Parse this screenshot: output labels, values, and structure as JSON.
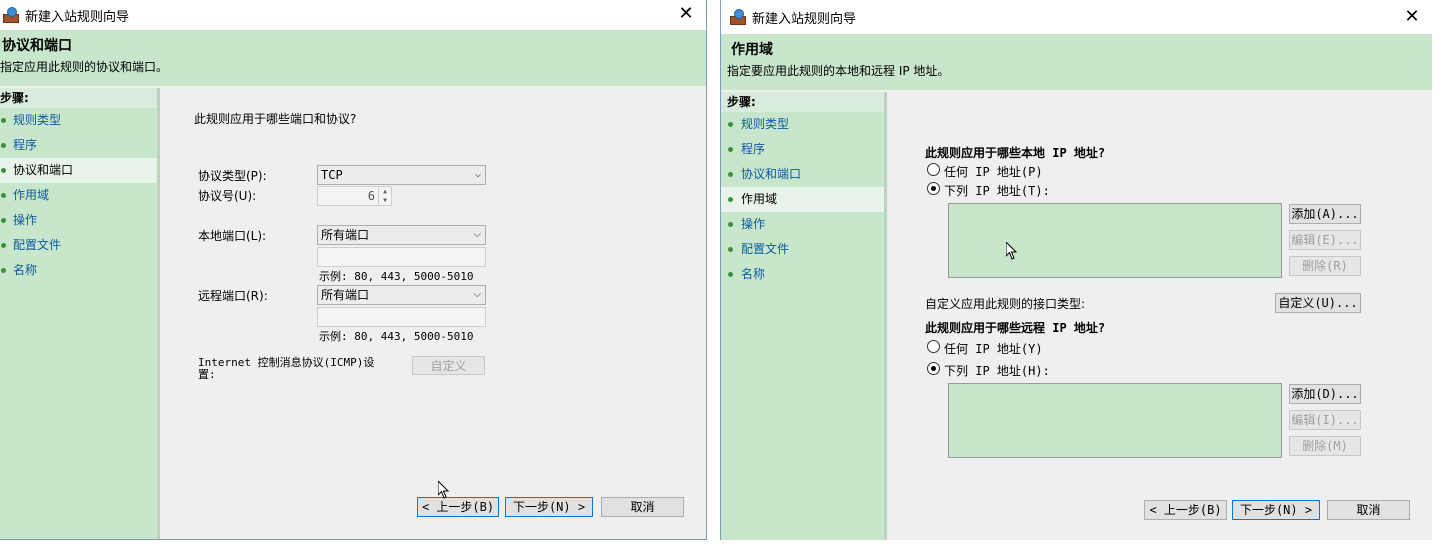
{
  "left_window": {
    "title": "新建入站规则向导",
    "header_title": "协议和端口",
    "header_desc": "指定应用此规则的协议和端口。",
    "steps_heading": "步骤:",
    "steps": [
      "规则类型",
      "程序",
      "协议和端口",
      "作用域",
      "操作",
      "配置文件",
      "名称"
    ],
    "active_step_index": 2,
    "question": "此规则应用于哪些端口和协议?",
    "protocol_type_label": "协议类型(P):",
    "protocol_type_value": "TCP",
    "protocol_number_label": "协议号(U):",
    "protocol_number_value": "6",
    "local_port_label": "本地端口(L):",
    "local_port_value": "所有端口",
    "local_port_example": "示例: 80, 443, 5000-5010",
    "remote_port_label": "远程端口(R):",
    "remote_port_value": "所有端口",
    "remote_port_example": "示例: 80, 443, 5000-5010",
    "icmp_label": "Internet 控制消息协议(ICMP)设置:",
    "customize_button": "自定义",
    "back_button": "< 上一步(B)",
    "next_button": "下一步(N) >",
    "cancel_button": "取消"
  },
  "right_window": {
    "title": "新建入站规则向导",
    "header_title": "作用域",
    "header_desc": "指定要应用此规则的本地和远程 IP 地址。",
    "steps_heading": "步骤:",
    "steps": [
      "规则类型",
      "程序",
      "协议和端口",
      "作用域",
      "操作",
      "配置文件",
      "名称"
    ],
    "active_step_index": 3,
    "local_question": "此规则应用于哪些本地 IP 地址?",
    "local_any": "任何 IP 地址(P)",
    "local_list": "下列 IP 地址(T):",
    "local_add": "添加(A)...",
    "local_edit": "编辑(E)...",
    "local_remove": "删除(R)",
    "interface_label": "自定义应用此规则的接口类型:",
    "interface_button": "自定义(U)...",
    "remote_question": "此规则应用于哪些远程 IP 地址?",
    "remote_any": "任何 IP 地址(Y)",
    "remote_list": "下列 IP 地址(H):",
    "remote_add": "添加(D)...",
    "remote_edit": "编辑(I)...",
    "remote_remove": "删除(M)",
    "back_button": "< 上一步(B)",
    "next_button": "下一步(N) >",
    "cancel_button": "取消"
  },
  "colors": {
    "panel_green": "#c8e6cc",
    "link_blue": "#0c5a9e",
    "dialog_gray": "#efefef",
    "focus_blue": "#0078d7"
  }
}
